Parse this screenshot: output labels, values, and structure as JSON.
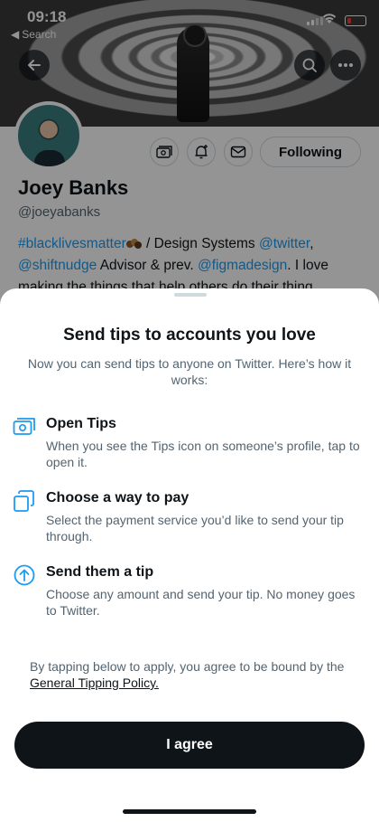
{
  "status": {
    "time": "09:18",
    "back_app": "Search"
  },
  "header": {
    "back_icon": "arrow-left-icon",
    "search_icon": "search-icon",
    "more_icon": "more-icon"
  },
  "profile": {
    "name": "Joey Banks",
    "handle": "@joeyabanks",
    "follow_label": "Following",
    "action_icons": [
      "tips-icon",
      "notification-bell-icon",
      "message-icon"
    ],
    "bio": {
      "hashtag": "#blacklivesmatter",
      "text1": " / Design Systems ",
      "mention1": "@twitter",
      "text2": ",",
      "mention2": "@shiftnudge",
      "text3": " Advisor & prev. ",
      "mention3": "@figmadesign",
      "text4": ". I love making the things that help others do their thing."
    }
  },
  "sheet": {
    "title": "Send tips to accounts you love",
    "subtitle": "Now you can send tips to anyone on Twitter. Here’s how it works:",
    "steps": [
      {
        "icon": "tips-icon",
        "title": "Open Tips",
        "description": "When you see the Tips icon on someone’s profile, tap to open it."
      },
      {
        "icon": "cards-icon",
        "title": "Choose a way to pay",
        "description": "Select the payment service you’d like to send your tip through."
      },
      {
        "icon": "arrow-up-circle-icon",
        "title": "Send them a tip",
        "description": "Choose any amount and send your tip. No money goes to Twitter."
      }
    ],
    "legal_text": "By tapping below to apply, you agree to be bound by the ",
    "legal_link": "General Tipping Policy.",
    "agree_label": "I agree"
  },
  "colors": {
    "accent": "#1d9bf0",
    "button": "#0f1419",
    "secondary_text": "#536471"
  }
}
